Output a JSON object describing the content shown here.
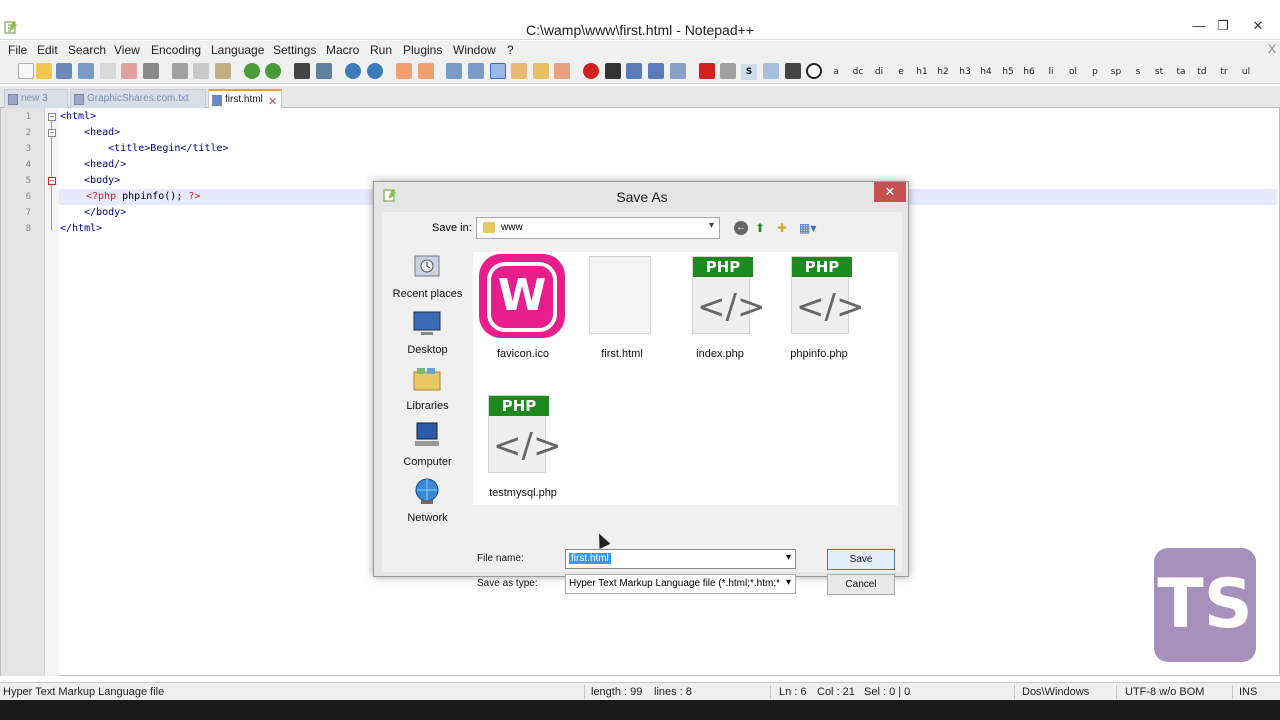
{
  "window": {
    "title": "C:\\wamp\\www\\first.html - Notepad++",
    "minimize_glyph": "—",
    "restore_glyph": "❐",
    "close_glyph": "✕"
  },
  "menubar": {
    "items": [
      "File",
      "Edit",
      "Search",
      "View",
      "Encoding",
      "Language",
      "Settings",
      "Macro",
      "Run",
      "Plugins",
      "Window",
      "?"
    ],
    "close_glyph": "X"
  },
  "toolbar": {
    "text_buttons": [
      "a",
      "dc",
      "di",
      "e",
      "h1",
      "h2",
      "h3",
      "h4",
      "h5",
      "h6",
      "li",
      "ol",
      "p",
      "sp",
      "s",
      "st",
      "ta",
      "td",
      "tr",
      "ul"
    ],
    "s_button": "S"
  },
  "tabs": [
    {
      "label": "new  3",
      "active": false
    },
    {
      "label": "GraphicShares.com.txt",
      "active": false
    },
    {
      "label": "first.html",
      "active": true
    }
  ],
  "editor": {
    "line_numbers": [
      "1",
      "2",
      "3",
      "4",
      "5",
      "6",
      "7",
      "8"
    ],
    "lines": [
      {
        "text": "<html>"
      },
      {
        "text": "    <head>"
      },
      {
        "text": "        <title>Begin</title>"
      },
      {
        "text": "    <head/>"
      },
      {
        "text": "    <body>"
      },
      {
        "php_open": "<?php",
        "php_mid": " phpinfo(); ",
        "php_close": "?>"
      },
      {
        "text": "    </body>"
      },
      {
        "text": "</html>"
      }
    ]
  },
  "dialog": {
    "title": "Save As",
    "close_glyph": "✕",
    "save_in_label": "Save in:",
    "save_in_value": "www",
    "places": [
      "Recent places",
      "Desktop",
      "Libraries",
      "Computer",
      "Network"
    ],
    "files": [
      {
        "name": "favicon.ico",
        "kind": "wamp"
      },
      {
        "name": "first.html",
        "kind": "blank"
      },
      {
        "name": "index.php",
        "kind": "php"
      },
      {
        "name": "phpinfo.php",
        "kind": "php"
      },
      {
        "name": "testmysql.php",
        "kind": "php"
      }
    ],
    "php_badge": "PHP",
    "php_code_glyph": "</>",
    "file_name_label": "File name:",
    "file_name_value": "first.html",
    "save_as_type_label": "Save as type:",
    "save_as_type_value": "Hyper Text Markup Language file (*.html;*.htm;*.",
    "save_button": "Save",
    "cancel_button": "Cancel"
  },
  "statusbar": {
    "file_type": "Hyper Text Markup Language file",
    "length": "length : 99",
    "lines": "lines : 8",
    "ln": "Ln : 6",
    "col": "Col : 21",
    "sel": "Sel : 0 | 0",
    "eol": "Dos\\Windows",
    "encoding": "UTF-8 w/o BOM",
    "mode": "INS"
  },
  "watermark": {
    "text": "TS"
  },
  "colors": {
    "wamp_pink": "#e81e8c",
    "php_green": "#1c8a1c",
    "selection_blue": "#3399ff",
    "dialog_close_red": "#c75050"
  }
}
